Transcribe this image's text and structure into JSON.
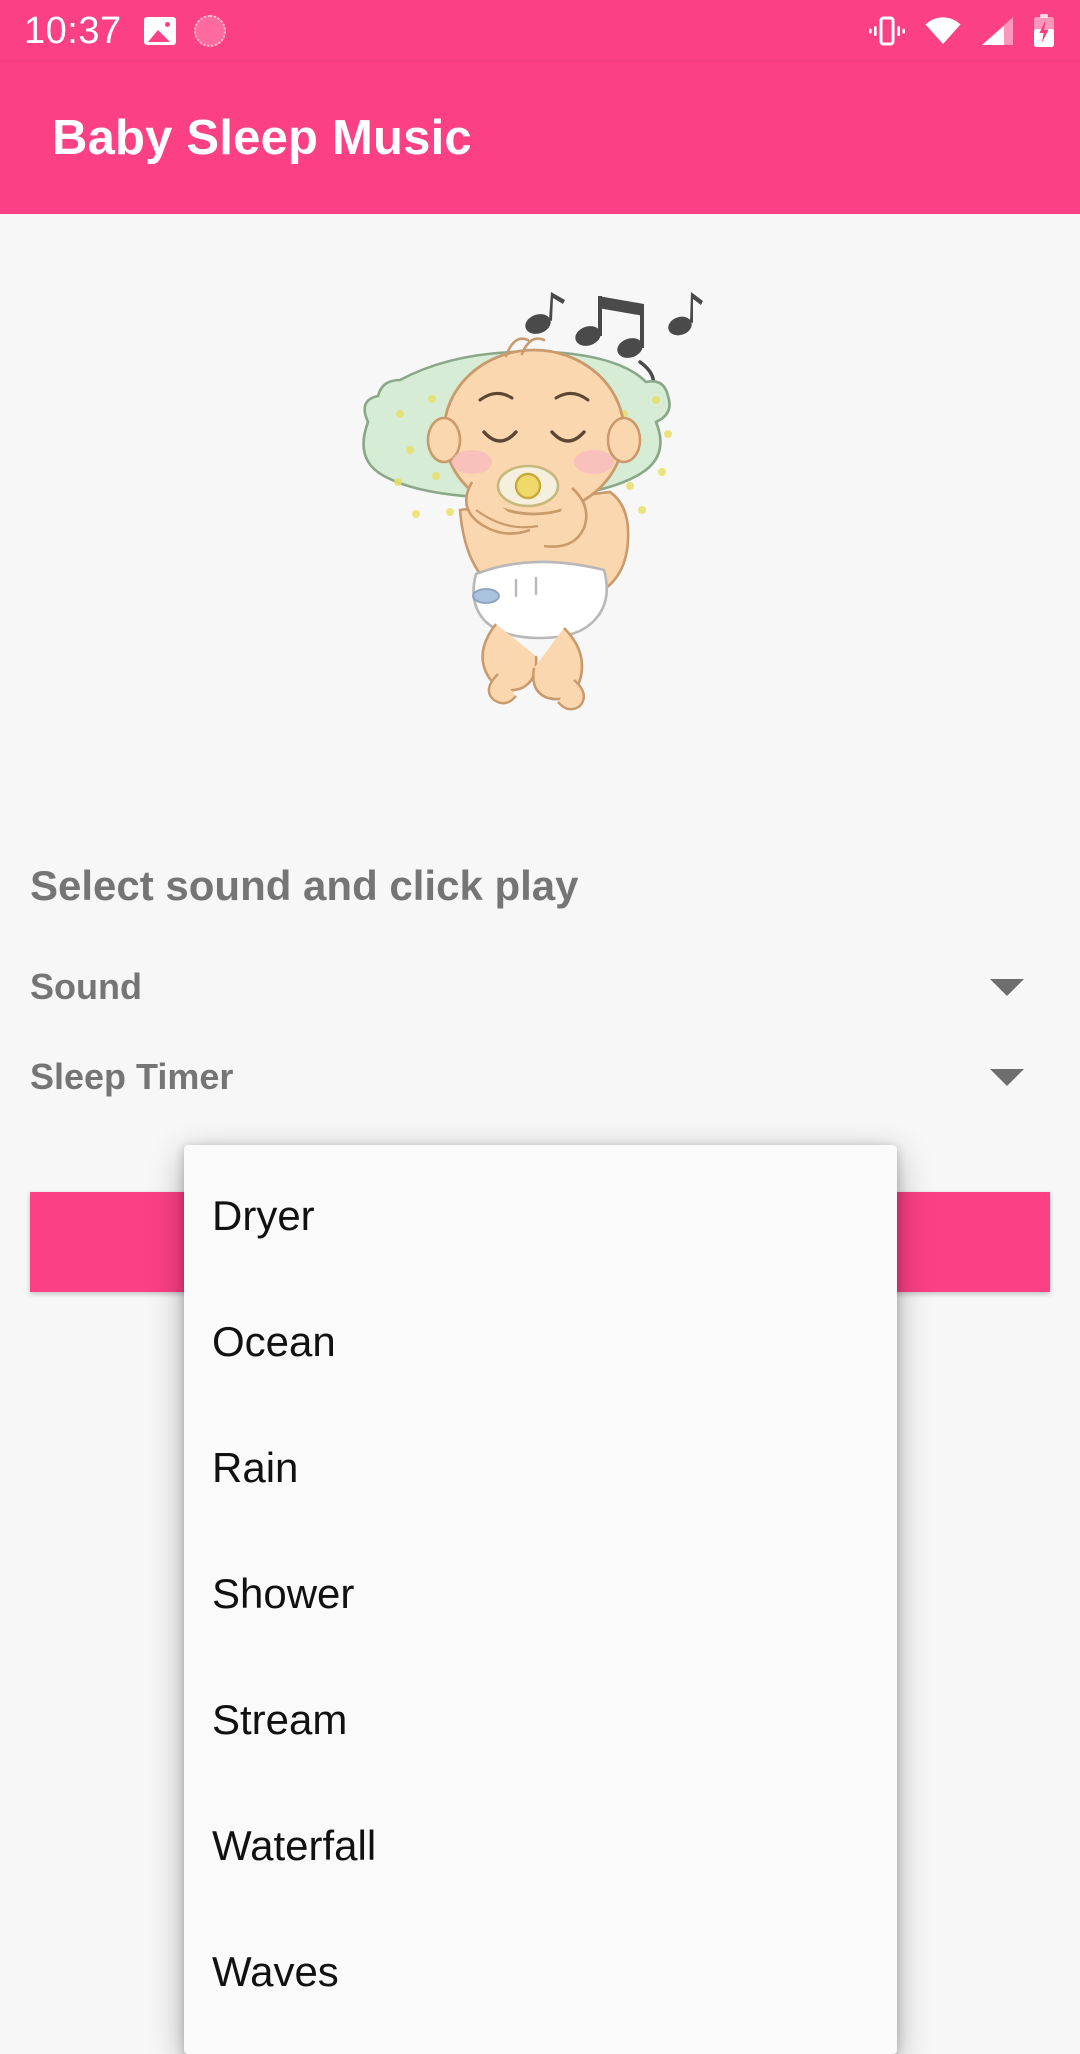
{
  "status_bar": {
    "clock": "10:37",
    "background_color": "#fb4083",
    "left_icons": [
      "photo-icon",
      "circle-badge-icon"
    ],
    "right_icons": [
      "vibrate-icon",
      "wifi-icon",
      "signal-icon",
      "battery-charging-icon"
    ]
  },
  "app_bar": {
    "title": "Baby Sleep Music",
    "background_color": "#fb4083",
    "title_color": "#ffffff"
  },
  "content": {
    "illustration": "sleeping-baby-with-music-notes",
    "instruction": "Select sound and click play",
    "fields": [
      {
        "label": "Sound",
        "caret": "chevron-down-icon"
      },
      {
        "label": "Sleep Timer",
        "caret": "chevron-down-icon"
      }
    ],
    "play_button": {
      "label": "",
      "color": "#fb4083"
    }
  },
  "sound_dropdown": {
    "open": true,
    "items": [
      {
        "label": "Dryer"
      },
      {
        "label": "Ocean"
      },
      {
        "label": "Rain"
      },
      {
        "label": "Shower"
      },
      {
        "label": "Stream"
      },
      {
        "label": "Waterfall"
      },
      {
        "label": "Waves"
      }
    ]
  }
}
